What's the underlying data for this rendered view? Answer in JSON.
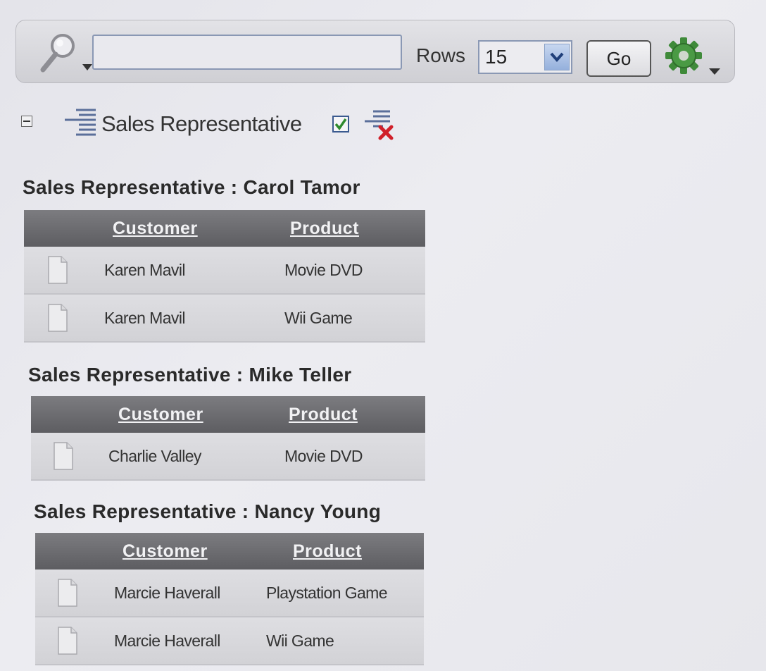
{
  "toolbar": {
    "search_icon": "magnifier-icon",
    "search_value": "",
    "rows_label": "Rows",
    "rows_value": "15",
    "go_label": "Go",
    "actions_icon": "gear-icon"
  },
  "control_break": {
    "label": "Sales Representative",
    "checked": true
  },
  "columns": {
    "customer": "Customer",
    "product": "Product"
  },
  "groups": [
    {
      "heading": "Sales Representative : Carol Tamor",
      "rows": [
        {
          "customer": "Karen Mavil",
          "product": "Movie DVD"
        },
        {
          "customer": "Karen Mavil",
          "product": "Wii Game"
        }
      ]
    },
    {
      "heading": "Sales Representative : Mike Teller",
      "rows": [
        {
          "customer": "Charlie Valley",
          "product": "Movie DVD"
        }
      ]
    },
    {
      "heading": "Sales Representative : Nancy Young",
      "rows": [
        {
          "customer": "Marcie Haverall",
          "product": "Playstation Game"
        },
        {
          "customer": "Marcie Haverall",
          "product": "Wii Game"
        }
      ]
    }
  ]
}
